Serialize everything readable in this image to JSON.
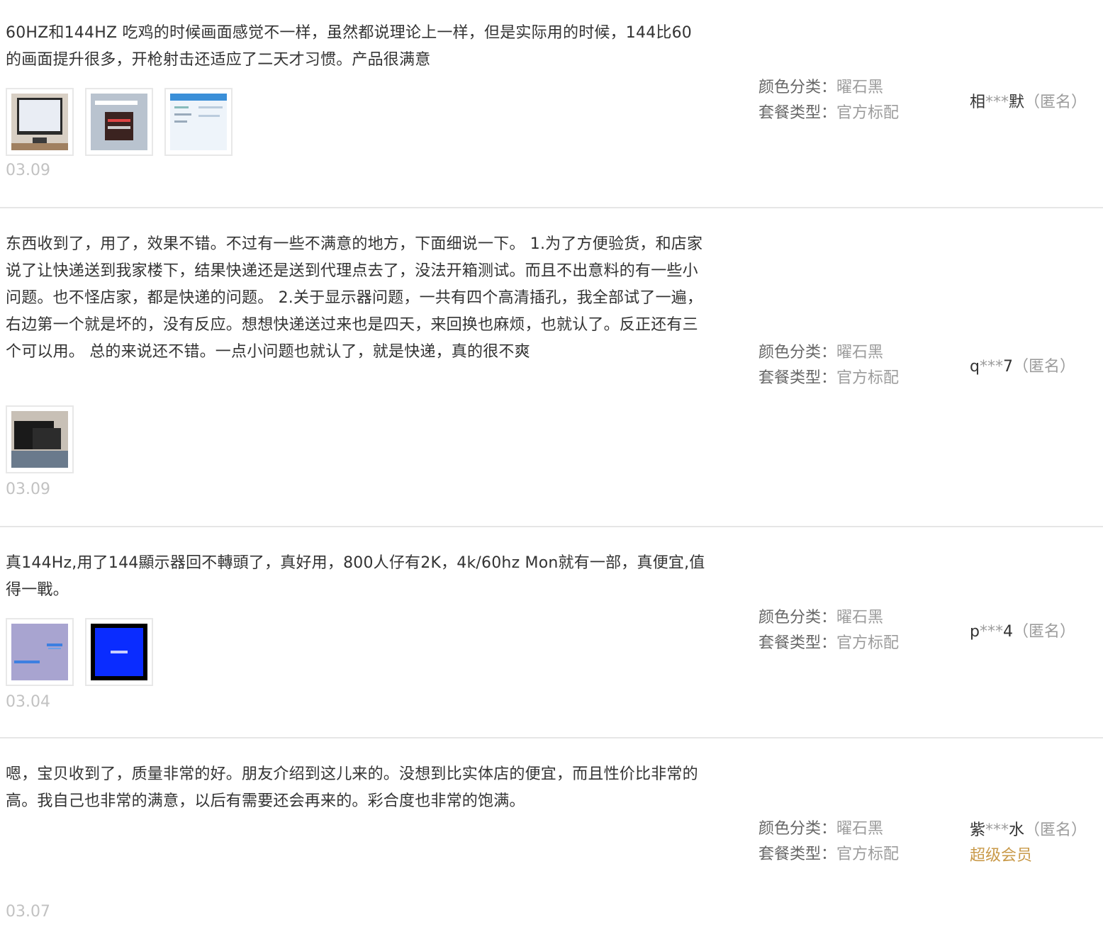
{
  "reviews": [
    {
      "content": "60HZ和144HZ 吃鸡的时候画面感觉不一样，虽然都说理论上一样，但是实际用的时候，144比60的画面提升很多，开枪射击还适应了二天才习惯。产品很满意",
      "date": "03.09",
      "sku": {
        "color_label": "颜色分类：",
        "color_value": "曜石黑",
        "pkg_label": "套餐类型：",
        "pkg_value": "官方标配"
      },
      "user": {
        "first": "相",
        "mask": "***",
        "last": "默",
        "anon": "（匿名）"
      }
    },
    {
      "content": "东西收到了，用了，效果不错。不过有一些不满意的地方，下面细说一下。 1.为了方便验货，和店家说了让快递送到我家楼下，结果快递还是送到代理点去了，没法开箱测试。而且不出意料的有一些小问题。也不怪店家，都是快递的问题。 2.关于显示器问题，一共有四个高清插孔，我全部试了一遍，右边第一个就是坏的，没有反应。想想快递送过来也是四天，来回换也麻烦，也就认了。反正还有三个可以用。 总的来说还不错。一点小问题也就认了，就是快递，真的很不爽",
      "date": "03.09",
      "sku": {
        "color_label": "颜色分类：",
        "color_value": "曜石黑",
        "pkg_label": "套餐类型：",
        "pkg_value": "官方标配"
      },
      "user": {
        "first": "q",
        "mask": "***",
        "last": "7",
        "anon": "（匿名）"
      }
    },
    {
      "content": "真144Hz,用了144顯示器回不轉頭了，真好用，800人仔有2K，4k/60hz Mon就有一部，真便宜,值得一戰。",
      "date": "03.04",
      "sku": {
        "color_label": "颜色分类：",
        "color_value": "曜石黑",
        "pkg_label": "套餐类型：",
        "pkg_value": "官方标配"
      },
      "user": {
        "first": "p",
        "mask": "***",
        "last": "4",
        "anon": "（匿名）"
      }
    },
    {
      "content": "嗯，宝贝收到了，质量非常的好。朋友介绍到这儿来的。没想到比实体店的便宜，而且性价比非常的高。我自己也非常的满意，以后有需要还会再来的。彩合度也非常的饱满。",
      "date": "03.07",
      "sku": {
        "color_label": "颜色分类：",
        "color_value": "曜石黑",
        "pkg_label": "套餐类型：",
        "pkg_value": "官方标配"
      },
      "user": {
        "first": "紫",
        "mask": "***",
        "last": "水",
        "anon": "（匿名）",
        "badge": "超级会员"
      }
    }
  ],
  "colors": {
    "text": "#333333",
    "muted": "#9c9c9c",
    "date": "#c2c2c2",
    "vip": "#c99a4a",
    "divider": "#e6e6e6"
  }
}
